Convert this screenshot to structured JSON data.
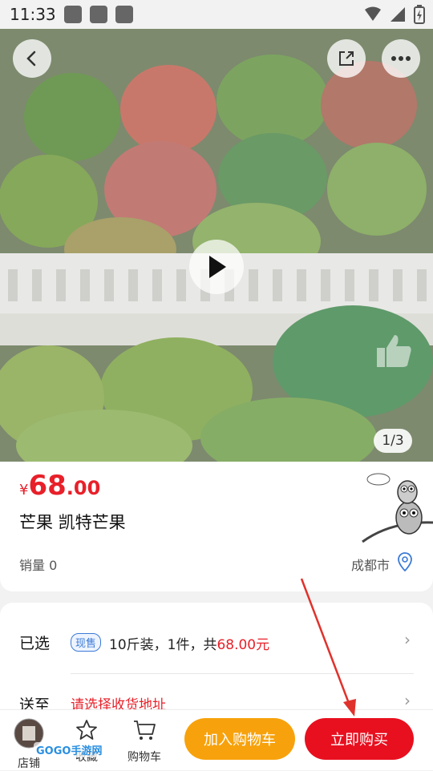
{
  "status_bar": {
    "time": "11:33"
  },
  "gallery": {
    "counter": "1/3"
  },
  "product": {
    "currency": "¥",
    "price_int": "68",
    "price_dec": ".00",
    "title": "芒果 凯特芒果",
    "sales": "销量 0",
    "location": "成都市"
  },
  "options": {
    "selected_label": "已选",
    "stock_tag": "现售",
    "selected_text": "10斤装，1件，共",
    "selected_total": "68.00元",
    "ship_label": "送至",
    "ship_placeholder": "请选择收货地址"
  },
  "bottom_bar": {
    "store_label": "店铺",
    "favorite_label": "收藏",
    "cart_label": "购物车",
    "add_cart_button": "加入购物车",
    "buy_now_button": "立即购买"
  },
  "watermark": "GOGO手游网",
  "colors": {
    "price_red": "#e8202a",
    "cart_orange": "#f7a20c",
    "buy_red": "#e8101f",
    "tag_blue": "#3b7ad6"
  }
}
